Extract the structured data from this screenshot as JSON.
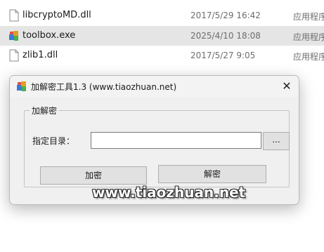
{
  "files": [
    {
      "name": "libcryptoMD.dll",
      "date": "2017/5/29 16:42",
      "type": "应用程序",
      "icon": "dll-file-icon",
      "selected": false
    },
    {
      "name": "toolbox.exe",
      "date": "2025/4/10 18:08",
      "type": "应用程序",
      "icon": "exe-app-icon",
      "selected": true
    },
    {
      "name": "zlib1.dll",
      "date": "2017/5/27 9:05",
      "type": "应用程序",
      "icon": "dll-file-icon",
      "selected": false
    }
  ],
  "dialog": {
    "title": "加解密工具1.3 (www.tiaozhuan.net)",
    "close_glyph": "✕",
    "group_label": "加解密",
    "dir_label": "指定目录：",
    "dir_value": "",
    "browse_label": "...",
    "encrypt_label": "加密",
    "decrypt_label": "解密"
  },
  "watermark": "www.tiaozhuan.net"
}
